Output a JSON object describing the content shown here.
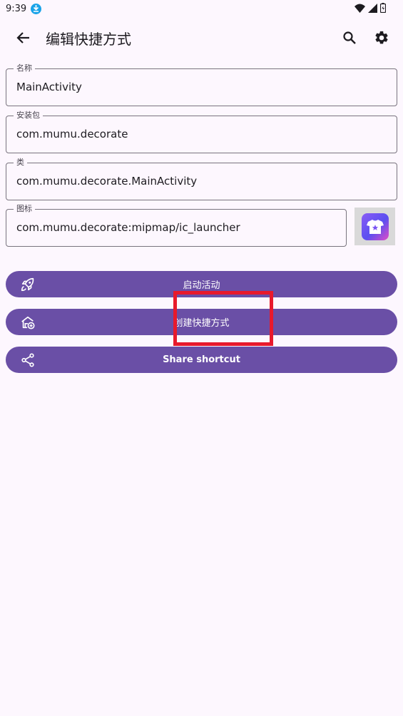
{
  "status_bar": {
    "time": "9:39",
    "icons": [
      "download-icon",
      "wifi-icon",
      "signal-icon",
      "battery-icon"
    ]
  },
  "app_bar": {
    "title": "编辑快捷方式",
    "icons": [
      "back-arrow-icon",
      "search-icon",
      "gear-icon"
    ]
  },
  "fields": [
    {
      "label": "名称",
      "value": "MainActivity"
    },
    {
      "label": "安装包",
      "value": "com.mumu.decorate"
    },
    {
      "label": "类",
      "value": "com.mumu.decorate.MainActivity"
    },
    {
      "label": "图标",
      "value": "com.mumu.decorate:mipmap/ic_launcher"
    }
  ],
  "buttons": [
    {
      "label": "启动活动",
      "icon": "rocket-icon"
    },
    {
      "label": "创建快捷方式",
      "icon": "add-home-icon"
    },
    {
      "label": "Share shortcut",
      "icon": "share-icon"
    }
  ],
  "colors": {
    "background": "#fdf7fe",
    "button": "#6a4fa6",
    "outline": "#79747e",
    "highlight": "#e8192c"
  }
}
